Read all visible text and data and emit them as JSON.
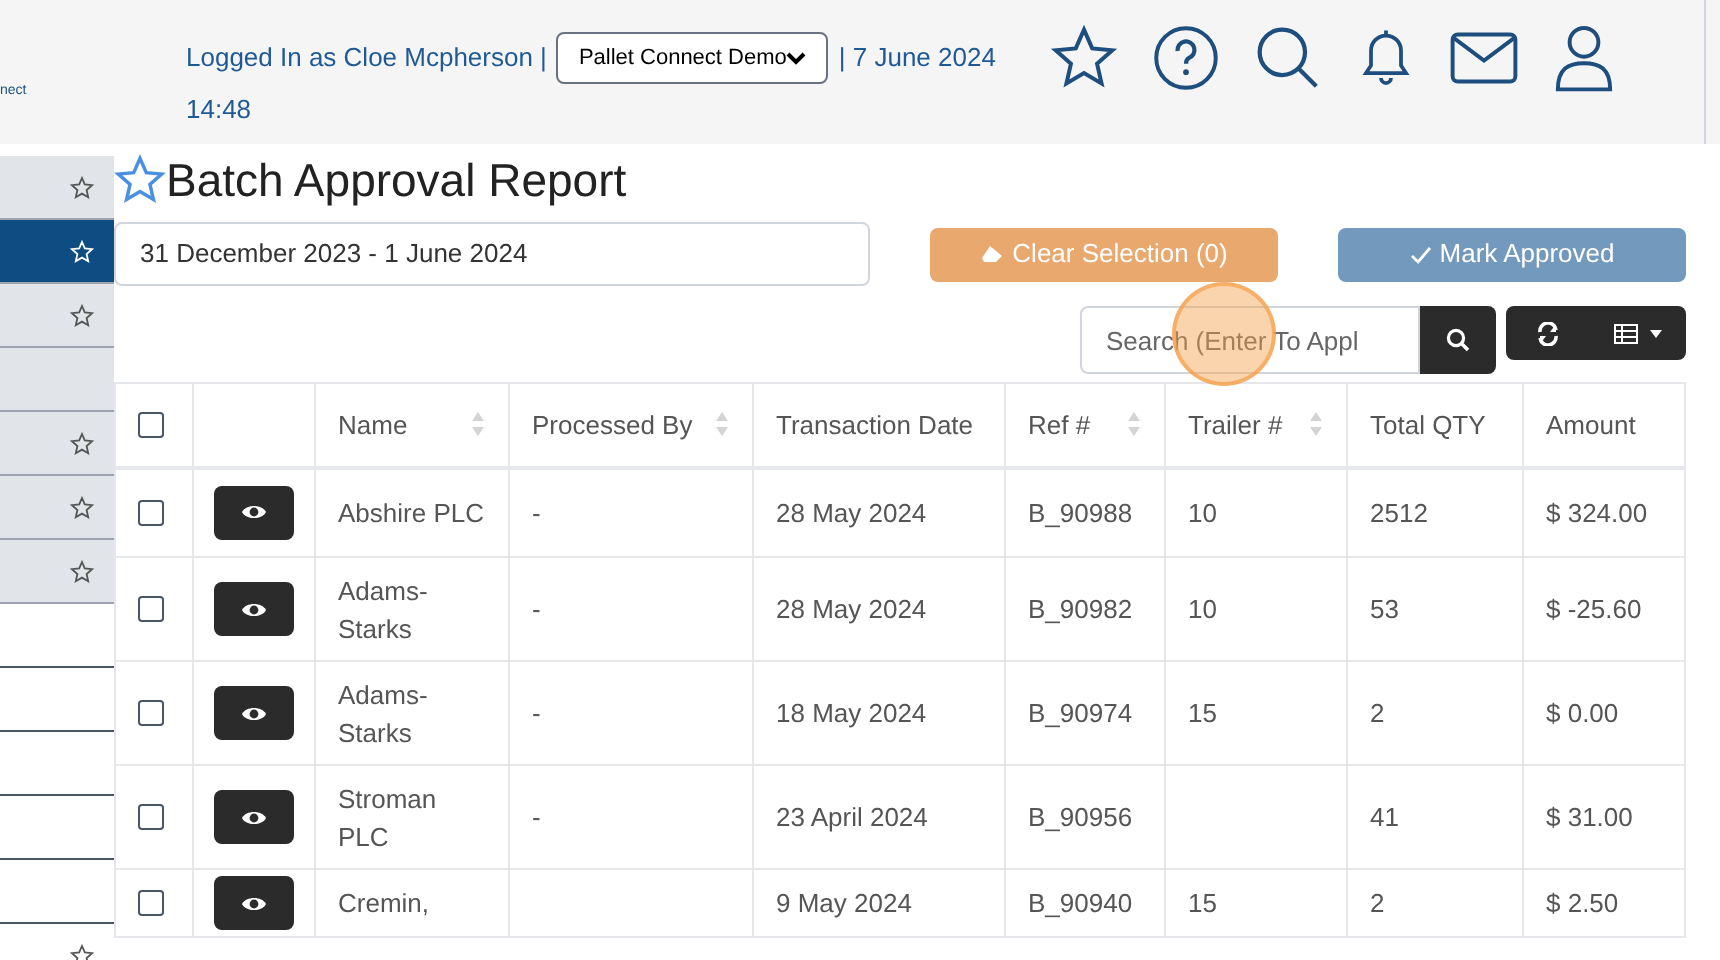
{
  "logo": {
    "text": "nect"
  },
  "header": {
    "user_text": "Logged In as Cloe Mcpherson |",
    "company_select": "Pallet Connect Demo",
    "date_text": "| 7 June 2024",
    "time_text": "14:48"
  },
  "sidebar": {
    "items": [
      {
        "starred": true,
        "selected": false,
        "shaded": true
      },
      {
        "starred": true,
        "selected": true,
        "shaded": true
      },
      {
        "starred": true,
        "selected": false,
        "shaded": true
      },
      {
        "starred": false,
        "selected": false,
        "shaded": true
      },
      {
        "starred": true,
        "selected": false,
        "shaded": true
      },
      {
        "starred": true,
        "selected": false,
        "shaded": true
      },
      {
        "starred": true,
        "selected": false,
        "shaded": true
      },
      {
        "starred": false,
        "selected": false,
        "shaded": false
      },
      {
        "starred": false,
        "selected": false,
        "shaded": false
      },
      {
        "starred": false,
        "selected": false,
        "shaded": false
      },
      {
        "starred": false,
        "selected": false,
        "shaded": false
      },
      {
        "starred": false,
        "selected": false,
        "shaded": false
      },
      {
        "starred": true,
        "selected": false,
        "shaded": false
      }
    ]
  },
  "page": {
    "title": "Batch Approval Report",
    "favorite": false,
    "date_range": "31 December 2023 - 1 June 2024",
    "clear_button": "Clear Selection (0)",
    "approve_button": "Mark Approved",
    "search_placeholder": "Search (Enter To Appl"
  },
  "table": {
    "select_all_checked": false,
    "columns": [
      {
        "sortable": false
      },
      {
        "sortable": false
      },
      {
        "label": "Name",
        "sortable": true
      },
      {
        "label": "Processed By",
        "sortable": true
      },
      {
        "label": "Transaction Date",
        "sortable": false
      },
      {
        "label": "Ref #",
        "sortable": true
      },
      {
        "label": "Trailer #",
        "sortable": true
      },
      {
        "label": "Total QTY",
        "sortable": false
      },
      {
        "label": "Amount",
        "sortable": false
      }
    ],
    "rows": [
      {
        "checked": false,
        "name": "Abshire PLC",
        "processed_by": "-",
        "date": "28 May 2024",
        "ref": "B_90988",
        "trailer": "10",
        "qty": "2512",
        "amount": "$ 324.00"
      },
      {
        "checked": false,
        "name": "Adams-Starks",
        "processed_by": "-",
        "date": "28 May 2024",
        "ref": "B_90982",
        "trailer": "10",
        "qty": "53",
        "amount": "$ -25.60"
      },
      {
        "checked": false,
        "name": "Adams-Starks",
        "processed_by": "-",
        "date": "18 May 2024",
        "ref": "B_90974",
        "trailer": "15",
        "qty": "2",
        "amount": "$ 0.00"
      },
      {
        "checked": false,
        "name": "Stroman PLC",
        "processed_by": "-",
        "date": "23 April 2024",
        "ref": "B_90956",
        "trailer": "",
        "qty": "41",
        "amount": "$ 31.00"
      },
      {
        "checked": false,
        "name": "Cremin,",
        "processed_by": "",
        "date": "9 May 2024",
        "ref": "B_90940",
        "trailer": "15",
        "qty": "2",
        "amount": "$ 2.50"
      }
    ]
  }
}
